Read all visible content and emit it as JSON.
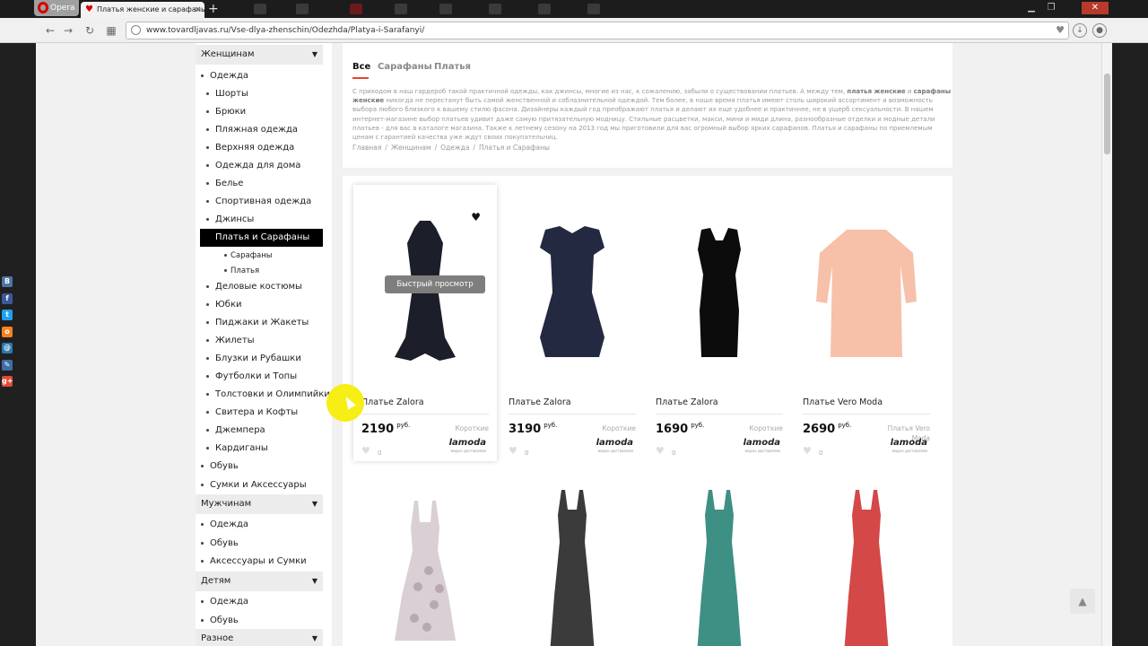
{
  "browser": {
    "app_label": "Opera",
    "tab_title": "Платья женские и сарафаны",
    "url": "www.tovardljavas.ru/Vse-dlya-zhenschin/Odezhda/Platya-i-Sarafanyi/",
    "new_tab_label": "+",
    "close_glyph": "×"
  },
  "sidebar": {
    "women": {
      "header": "Женщинам",
      "top_items": [
        "Одежда"
      ],
      "clothing_items": [
        "Шорты",
        "Брюки",
        "Пляжная одежда",
        "Верхняя одежда",
        "Одежда для дома",
        "Белье",
        "Спортивная одежда",
        "Джинсы"
      ],
      "active_item": "Платья и Сарафаны",
      "sub_items": [
        "Сарафаны",
        "Платья"
      ],
      "more_items": [
        "Деловые костюмы",
        "Юбки",
        "Пиджаки и Жакеты",
        "Жилеты",
        "Блузки и Рубашки",
        "Футболки и Топы",
        "Толстовки и Олимпийки",
        "Свитера и Кофты",
        "Джемпера",
        "Кардиганы"
      ],
      "bottom_items": [
        "Обувь",
        "Сумки и Аксессуары"
      ]
    },
    "men": {
      "header": "Мужчинам",
      "items": [
        "Одежда",
        "Обувь",
        "Аксессуары и Сумки"
      ]
    },
    "kids": {
      "header": "Детям",
      "items": [
        "Одежда",
        "Обувь"
      ]
    },
    "misc": {
      "header": "Разное"
    }
  },
  "filters": {
    "all": "Все",
    "sundresses": "Сарафаны",
    "dresses": "Платья"
  },
  "description": {
    "p1": "С приходом в наш гардероб такой практичной одежды, как джинсы, многие из нас, к сожалению, забыли о существовании платьев. А между тем, ",
    "b1": "платья женские",
    "p2": " и ",
    "b2": "сарафаны женские",
    "p3": " никогда не перестанут быть самой женственной и соблазнительной одеждой. Тем более, в наше время платья имеют столь широкий ассортимент и возможность выбора любого близкого к вашему стилю фасона. Дизайнеры каждый год преображают платья и делают их еще удобнее и практичнее, не в ущерб сексуальности. В нашем интернет-магазине выбор платьев удивит даже самую притязательную модницу. Стильные расцветки, макси, мини и миди длина, разнообразные отделки и модные детали платьев - для вас в каталоге магазина. Также к летнему сезону на 2013 год мы приготовили для вас огромный выбор ярких сарафанов. Платья и сарафаны по приемлемым ценам с гарантией качества уже ждут своих покупательниц."
  },
  "breadcrumbs": [
    "Главная",
    "Женщинам",
    "Одежда",
    "Платья и Сарафаны"
  ],
  "breadcrumb_sep": "/",
  "products": [
    {
      "title": "Платье Zalora",
      "price": "2190",
      "currency": "руб.",
      "category": "Короткие",
      "store": "lamoda",
      "store_sub": "модно доставляем",
      "likes": "0",
      "color": "#1c1f29"
    },
    {
      "title": "Платье Zalora",
      "price": "3190",
      "currency": "руб.",
      "category": "Короткие",
      "store": "lamoda",
      "store_sub": "модно доставляем",
      "likes": "0",
      "color": "#232940"
    },
    {
      "title": "Платье Zalora",
      "price": "1690",
      "currency": "руб.",
      "category": "Короткие",
      "store": "lamoda",
      "store_sub": "модно доставляем",
      "likes": "0",
      "color": "#0c0c0c"
    },
    {
      "title": "Платье Vero Moda",
      "price": "2690",
      "currency": "руб.",
      "category": "Платья Vero Moda",
      "store": "lamoda",
      "store_sub": "модно доставляем",
      "likes": "0",
      "color": "#f7c0a8"
    }
  ],
  "products_row2_colors": [
    "#d9cfd4",
    "#3b3b3b",
    "#3e8f84",
    "#d44848"
  ],
  "quick_view": "Быстрый просмотр",
  "icons": {
    "wishlist": "heart-icon",
    "like": "heart-icon",
    "scroll_top": "arrow-up-icon",
    "social": [
      "vk-icon",
      "facebook-icon",
      "twitter-icon",
      "odnoklassniki-icon",
      "mailru-icon",
      "livejournal-icon",
      "google-plus-icon"
    ]
  },
  "social_colors": [
    "#4c75a3",
    "#3b5998",
    "#1da1f2",
    "#f58220",
    "#2a7ab0",
    "#3d6ea8",
    "#dd4b39"
  ],
  "social_letters": [
    "В",
    "f",
    "t",
    "о",
    "@",
    "✎",
    "g+"
  ],
  "accent_color": "#e8452c"
}
